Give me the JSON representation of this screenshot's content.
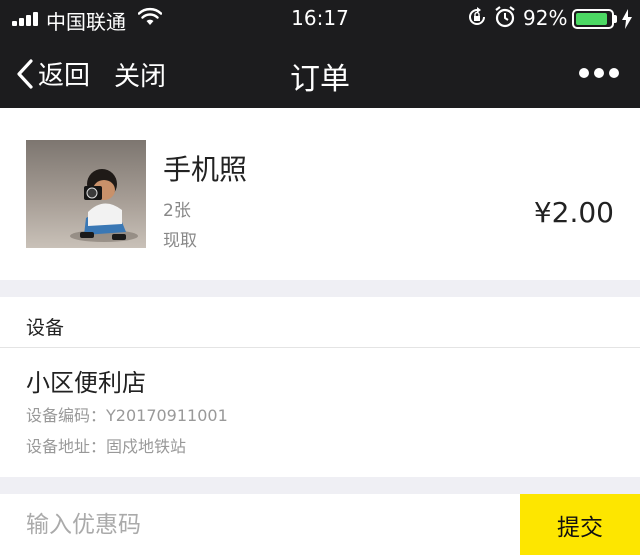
{
  "status_bar": {
    "carrier": "中国联通",
    "time": "16:17",
    "battery_percent": "92%",
    "battery_level": 0.92,
    "signal_bars": 4,
    "icons": [
      "signal-icon",
      "wifi-icon",
      "rotation-lock-icon",
      "alarm-icon",
      "battery-icon",
      "charging-icon"
    ]
  },
  "nav": {
    "back_label": "返回",
    "close_label": "关闭",
    "title": "订单",
    "more_icon": "more-icon"
  },
  "product": {
    "name": "手机照",
    "quantity": "2张",
    "pickup": "现取",
    "price": "¥2.00"
  },
  "device": {
    "header": "设备",
    "store_name": "小区便利店",
    "code": "设备编码：Y20170911001",
    "address": "设备地址：固戍地铁站"
  },
  "bottom": {
    "coupon_placeholder": "输入优惠码",
    "submit_label": "提交"
  },
  "colors": {
    "nav_background": "#1c1c1e",
    "page_background": "#efeff4",
    "submit_button": "#fde600",
    "battery": "#4cd964"
  }
}
